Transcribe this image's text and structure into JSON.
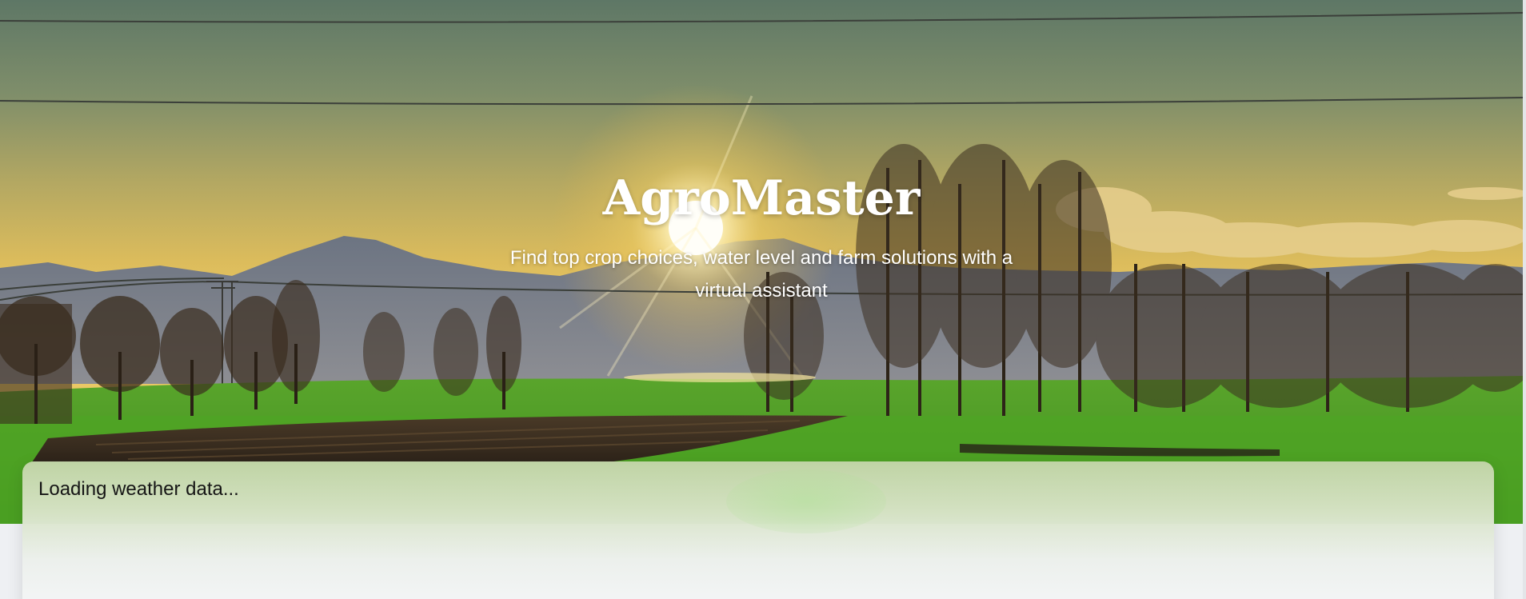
{
  "hero": {
    "title": "AgroMaster",
    "subtitle": "Find top crop choices, water level and farm solutions with a virtual assistant"
  },
  "weather": {
    "status": "Loading weather data..."
  },
  "colors": {
    "sky_top": "#5f7a68",
    "sky_glow": "#e8c25a",
    "sun": "#fffbe6",
    "mountains": "#5c6675",
    "field_green": "#55b22c",
    "field_dark": "#3a2f22",
    "card_top": "#c4d6aa",
    "card_bottom": "#f5f6f8",
    "text_dark": "#151515",
    "text_light": "#ffffff"
  },
  "icons": [
    "sun-icon"
  ]
}
